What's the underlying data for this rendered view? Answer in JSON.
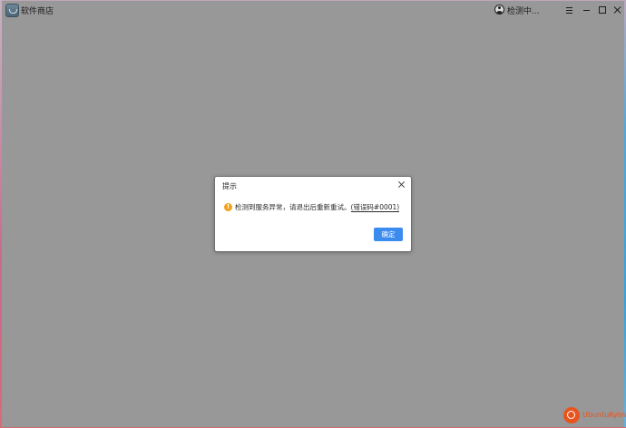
{
  "window": {
    "title": "软件商店",
    "status": "检测中...",
    "controls": [
      "menu",
      "minimize",
      "maximize",
      "close"
    ]
  },
  "dialog": {
    "title": "提示",
    "message": "检测到服务异常，请退出后重新重试。",
    "error_code": "(错误码#0001)",
    "ok_label": "确定",
    "icon": "warning-icon"
  },
  "brand": {
    "label": "UbuntuKylin"
  },
  "colors": {
    "overlay": "#989898",
    "accent": "#3c8cf0",
    "warning": "#f0a21c",
    "brand": "#e8541e"
  }
}
